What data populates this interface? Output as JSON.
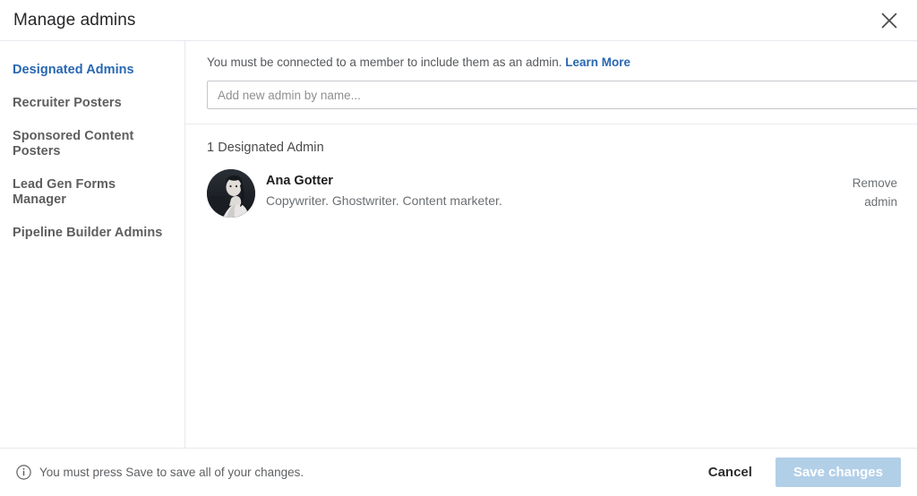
{
  "header": {
    "title": "Manage admins",
    "close_icon": "close-icon"
  },
  "sidebar": {
    "items": [
      {
        "label": "Designated Admins",
        "active": true
      },
      {
        "label": "Recruiter Posters",
        "active": false
      },
      {
        "label": "Sponsored Content Posters",
        "active": false
      },
      {
        "label": "Lead Gen Forms Manager",
        "active": false
      },
      {
        "label": "Pipeline Builder Admins",
        "active": false
      }
    ]
  },
  "main": {
    "notice_text": "You must be connected to a member to include them as an admin.",
    "notice_link": "Learn More",
    "input_placeholder": "Add new admin by name...",
    "input_value": "",
    "list_count": "1 Designated Admin",
    "admins": [
      {
        "name": "Ana Gotter",
        "headline": "Copywriter. Ghostwriter. Content marketer.",
        "remove_label": "Remove admin",
        "avatar_icon": "avatar"
      }
    ]
  },
  "footer": {
    "info_icon": "info-icon",
    "note": "You must press Save to save all of your changes.",
    "cancel_label": "Cancel",
    "save_label": "Save changes"
  },
  "colors": {
    "accent_blue": "#2867b2",
    "save_disabled": "#b2cfe8",
    "border": "#e6e9ec",
    "text_primary": "#27272a",
    "text_secondary": "#6b6f73"
  }
}
